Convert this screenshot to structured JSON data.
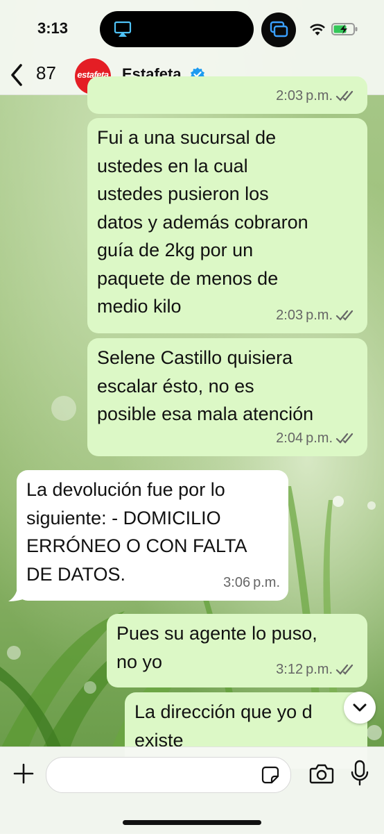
{
  "status_bar": {
    "time": "3:13"
  },
  "header": {
    "unread_count": "87",
    "avatar_text": "estafeta",
    "chat_name": "Estafeta"
  },
  "messages": [
    {
      "direction": "out",
      "time": "2:03 p.m.",
      "lines": []
    },
    {
      "direction": "out",
      "time": "2:03 p.m.",
      "lines": [
        "Fui a una sucursal de",
        "ustedes en la cual",
        "ustedes pusieron los",
        "datos y además cobraron",
        "guía de 2kg por un",
        "paquete de menos de",
        "medio kilo"
      ]
    },
    {
      "direction": "out",
      "time": "2:04 p.m.",
      "lines": [
        "Selene Castillo quisiera",
        "escalar ésto, no es",
        "posible esa mala atención"
      ]
    },
    {
      "direction": "in",
      "time": "3:06 p.m.",
      "lines": [
        "La devolución fue por lo",
        "siguiente: - DOMICILIO",
        "ERRÓNEO O CON FALTA",
        "DE DATOS."
      ]
    },
    {
      "direction": "out",
      "time": "3:12 p.m.",
      "lines": [
        "Pues su agente lo puso,",
        "no yo"
      ]
    },
    {
      "direction": "out",
      "time": "",
      "lines": [
        "La dirección que yo d",
        "existe"
      ]
    }
  ],
  "input": {
    "placeholder": "",
    "value": ""
  },
  "colors": {
    "outgoing_bubble": "#dcf8c6",
    "incoming_bubble": "#ffffff",
    "verified": "#1d9bf0"
  }
}
